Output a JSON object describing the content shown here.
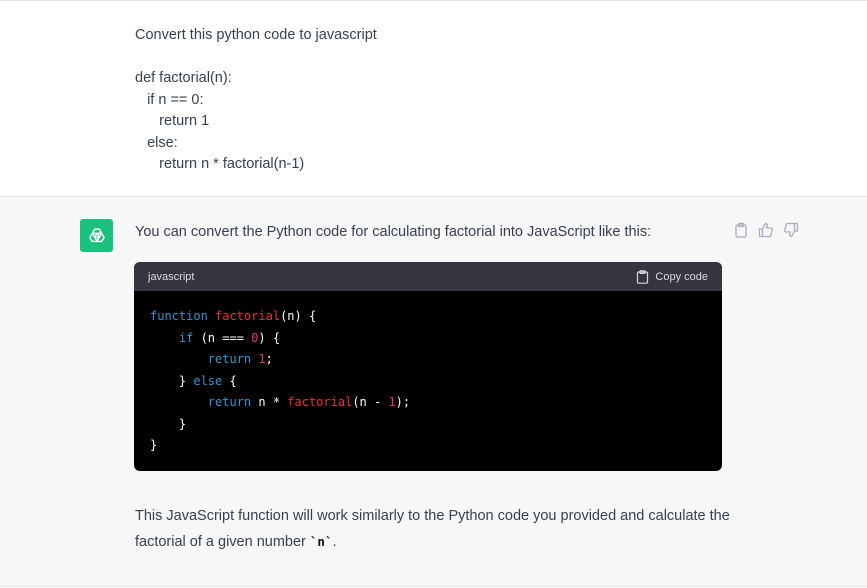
{
  "user_message": {
    "text": "Convert this python code to javascript\n\ndef factorial(n):\n   if n == 0:\n      return 1\n   else:\n      return n * factorial(n-1)"
  },
  "assistant_message": {
    "intro": "You can convert the Python code for calculating factorial into JavaScript like this:",
    "avatar_icon": "openai-logo-icon",
    "avatar_color": "#19c37d",
    "actions": [
      "clipboard-icon",
      "thumbs-up-icon",
      "thumbs-down-icon"
    ],
    "code_block": {
      "language": "javascript",
      "copy_label": "Copy code",
      "lines": [
        [
          {
            "t": "function",
            "c": "kw"
          },
          {
            "t": " "
          },
          {
            "t": "factorial",
            "c": "fn"
          },
          {
            "t": "(n) {"
          }
        ],
        [
          {
            "t": "    "
          },
          {
            "t": "if",
            "c": "kw"
          },
          {
            "t": " (n === "
          },
          {
            "t": "0",
            "c": "num"
          },
          {
            "t": ") {"
          }
        ],
        [
          {
            "t": "        "
          },
          {
            "t": "return",
            "c": "kw"
          },
          {
            "t": " "
          },
          {
            "t": "1",
            "c": "num"
          },
          {
            "t": ";"
          }
        ],
        [
          {
            "t": "    } "
          },
          {
            "t": "else",
            "c": "kw"
          },
          {
            "t": " {"
          }
        ],
        [
          {
            "t": "        "
          },
          {
            "t": "return",
            "c": "kw"
          },
          {
            "t": " n * "
          },
          {
            "t": "factorial",
            "c": "fn"
          },
          {
            "t": "(n - "
          },
          {
            "t": "1",
            "c": "num"
          },
          {
            "t": ");"
          }
        ],
        [
          {
            "t": "    }"
          }
        ],
        [
          {
            "t": "}"
          }
        ]
      ]
    },
    "outro_before": "This JavaScript function will work similarly to the Python code you provided and calculate the factorial of a given number ",
    "outro_code": "`n`",
    "outro_after": "."
  }
}
